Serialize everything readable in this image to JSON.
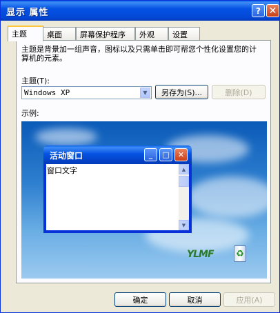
{
  "window": {
    "title": "显示 属性",
    "help_symbol": "?",
    "close_symbol": "✕"
  },
  "tabs": [
    {
      "label": "主题",
      "active": true
    },
    {
      "label": "桌面",
      "active": false
    },
    {
      "label": "屏幕保护程序",
      "active": false
    },
    {
      "label": "外观",
      "active": false
    },
    {
      "label": "设置",
      "active": false
    }
  ],
  "theme_panel": {
    "description": "主题是背景加一组声音，图标以及只需单击即可帮您个性化设置您的计算机的元素。",
    "theme_label": "主题(T):",
    "theme_value": "Windows XP",
    "save_as_label": "另存为(S)...",
    "delete_label": "删除(D)",
    "sample_label": "示例:"
  },
  "preview": {
    "window_title": "活动窗口",
    "window_text": "窗口文字",
    "logo_text": "YLMF"
  },
  "footer": {
    "ok_label": "确定",
    "cancel_label": "取消",
    "apply_label": "应用(A)"
  },
  "colors": {
    "title_bar": "#0553e3",
    "dialog_bg": "#ece9d8",
    "close_red": "#c8401b",
    "tab_highlight": "#ffc83c"
  }
}
